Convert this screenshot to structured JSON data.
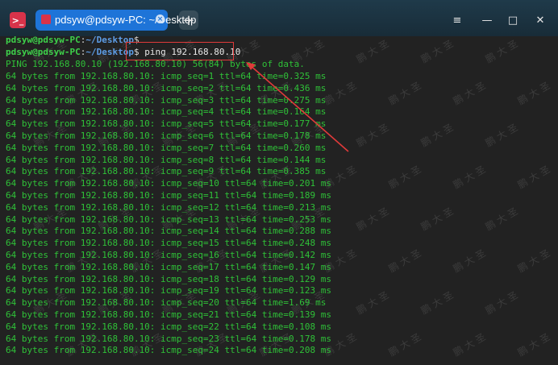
{
  "window": {
    "tab_title": "pdsyw@pdsyw-PC: ~/Desktop",
    "app_icon": "terminal-icon",
    "new_tab_label": "+",
    "controls": {
      "menu": "≡",
      "minimize": "—",
      "maximize": "□",
      "close": "✕"
    }
  },
  "terminal": {
    "prompt_user": "pdsyw@pdsyw-PC",
    "prompt_sep": ":",
    "prompt_path": "~/Desktop",
    "prompt_symbol": "$",
    "command": "ping 192.168.80.10",
    "ping_header": "PING 192.168.80.10 (192.168.80.10) 56(84) bytes of data.",
    "replies": [
      "64 bytes from 192.168.80.10: icmp_seq=1 ttl=64 time=0.325 ms",
      "64 bytes from 192.168.80.10: icmp_seq=2 ttl=64 time=0.436 ms",
      "64 bytes from 192.168.80.10: icmp_seq=3 ttl=64 time=0.275 ms",
      "64 bytes from 192.168.80.10: icmp_seq=4 ttl=64 time=0.164 ms",
      "64 bytes from 192.168.80.10: icmp_seq=5 ttl=64 time=0.177 ms",
      "64 bytes from 192.168.80.10: icmp_seq=6 ttl=64 time=0.178 ms",
      "64 bytes from 192.168.80.10: icmp_seq=7 ttl=64 time=0.260 ms",
      "64 bytes from 192.168.80.10: icmp_seq=8 ttl=64 time=0.144 ms",
      "64 bytes from 192.168.80.10: icmp_seq=9 ttl=64 time=0.385 ms",
      "64 bytes from 192.168.80.10: icmp_seq=10 ttl=64 time=0.201 ms",
      "64 bytes from 192.168.80.10: icmp_seq=11 ttl=64 time=0.189 ms",
      "64 bytes from 192.168.80.10: icmp_seq=12 ttl=64 time=0.213 ms",
      "64 bytes from 192.168.80.10: icmp_seq=13 ttl=64 time=0.253 ms",
      "64 bytes from 192.168.80.10: icmp_seq=14 ttl=64 time=0.288 ms",
      "64 bytes from 192.168.80.10: icmp_seq=15 ttl=64 time=0.248 ms",
      "64 bytes from 192.168.80.10: icmp_seq=16 ttl=64 time=0.142 ms",
      "64 bytes from 192.168.80.10: icmp_seq=17 ttl=64 time=0.147 ms",
      "64 bytes from 192.168.80.10: icmp_seq=18 ttl=64 time=0.129 ms",
      "64 bytes from 192.168.80.10: icmp_seq=19 ttl=64 time=0.123 ms",
      "64 bytes from 192.168.80.10: icmp_seq=20 ttl=64 time=1.69 ms",
      "64 bytes from 192.168.80.10: icmp_seq=21 ttl=64 time=0.139 ms",
      "64 bytes from 192.168.80.10: icmp_seq=22 ttl=64 time=0.108 ms",
      "64 bytes from 192.168.80.10: icmp_seq=23 ttl=64 time=0.178 ms",
      "64 bytes from 192.168.80.10: icmp_seq=24 ttl=64 time=0.208 ms"
    ]
  },
  "watermark": {
    "glyphs": [
      "鹏",
      "大",
      "圣"
    ],
    "color": "#969696"
  },
  "colors": {
    "prompt_user": "#3ed14a",
    "prompt_path": "#5d9de6",
    "output": "#2fc138",
    "annotation": "#e03a3a",
    "tab_active": "#1e74d8"
  }
}
